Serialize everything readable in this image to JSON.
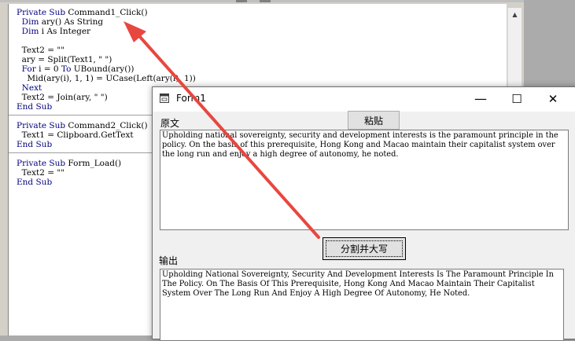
{
  "code_editor": {
    "lines": [
      {
        "parts": [
          {
            "t": "Private Sub",
            "kw": true
          },
          {
            "t": " Command1_Click()"
          }
        ]
      },
      {
        "parts": [
          {
            "t": "  Dim",
            "kw": true
          },
          {
            "t": " ary() As String"
          }
        ]
      },
      {
        "parts": [
          {
            "t": "  Dim",
            "kw": true
          },
          {
            "t": " i As Integer"
          }
        ]
      },
      {
        "parts": [
          {
            "t": ""
          }
        ]
      },
      {
        "parts": [
          {
            "t": "  Text2 = \"\""
          }
        ]
      },
      {
        "parts": [
          {
            "t": "  ary = Split(Text1, \" \")"
          }
        ]
      },
      {
        "parts": [
          {
            "t": "  For",
            "kw": true
          },
          {
            "t": " i = 0 "
          },
          {
            "t": "To",
            "kw": true
          },
          {
            "t": " UBound(ary())"
          }
        ]
      },
      {
        "parts": [
          {
            "t": "    Mid(ary(i), 1, 1) = UCase(Left(ary(i), 1))"
          }
        ]
      },
      {
        "parts": [
          {
            "t": "  Next",
            "kw": true
          }
        ]
      },
      {
        "parts": [
          {
            "t": "  Text2 = Join(ary, \" \")"
          }
        ]
      },
      {
        "parts": [
          {
            "t": "End Sub",
            "kw": true
          }
        ]
      },
      {
        "parts": [
          {
            "t": "Private Sub",
            "kw": true
          },
          {
            "t": " Command2_Click()"
          }
        ]
      },
      {
        "parts": [
          {
            "t": "  Text1 = Clipboard.GetText"
          }
        ]
      },
      {
        "parts": [
          {
            "t": "End Sub",
            "kw": true
          }
        ]
      },
      {
        "parts": [
          {
            "t": "Private Sub",
            "kw": true
          },
          {
            "t": " Form_Load()"
          }
        ]
      },
      {
        "parts": [
          {
            "t": "  Text2 = \"\""
          }
        ]
      },
      {
        "parts": [
          {
            "t": "End Sub",
            "kw": true
          }
        ]
      }
    ]
  },
  "form": {
    "title": "Form1",
    "minimize_glyph": "—",
    "maximize_glyph": "☐",
    "close_glyph": "✕",
    "source_label": "原文",
    "paste_button": "粘贴",
    "split_button": "分割并大写",
    "output_label": "输出",
    "source_text": "Upholding national sovereignty, security and development interests is the paramount principle in the policy. On the basis of this prerequisite, Hong Kong and Macao maintain their capitalist system over the long run and enjoy a high degree of autonomy, he noted.",
    "output_text": "Upholding National Sovereignty, Security And Development Interests Is The Paramount Principle In The Policy. On The Basis Of This Prerequisite, Hong Kong And Macao Maintain Their Capitalist System Over The Long Run And Enjoy A High Degree Of Autonomy, He Noted."
  },
  "colors": {
    "keyword": "#00007f",
    "annotation_arrow": "#e8473f"
  },
  "icons": {
    "scroll_up": "scroll-up-arrow-icon",
    "form_icon": "vb-form-icon"
  }
}
